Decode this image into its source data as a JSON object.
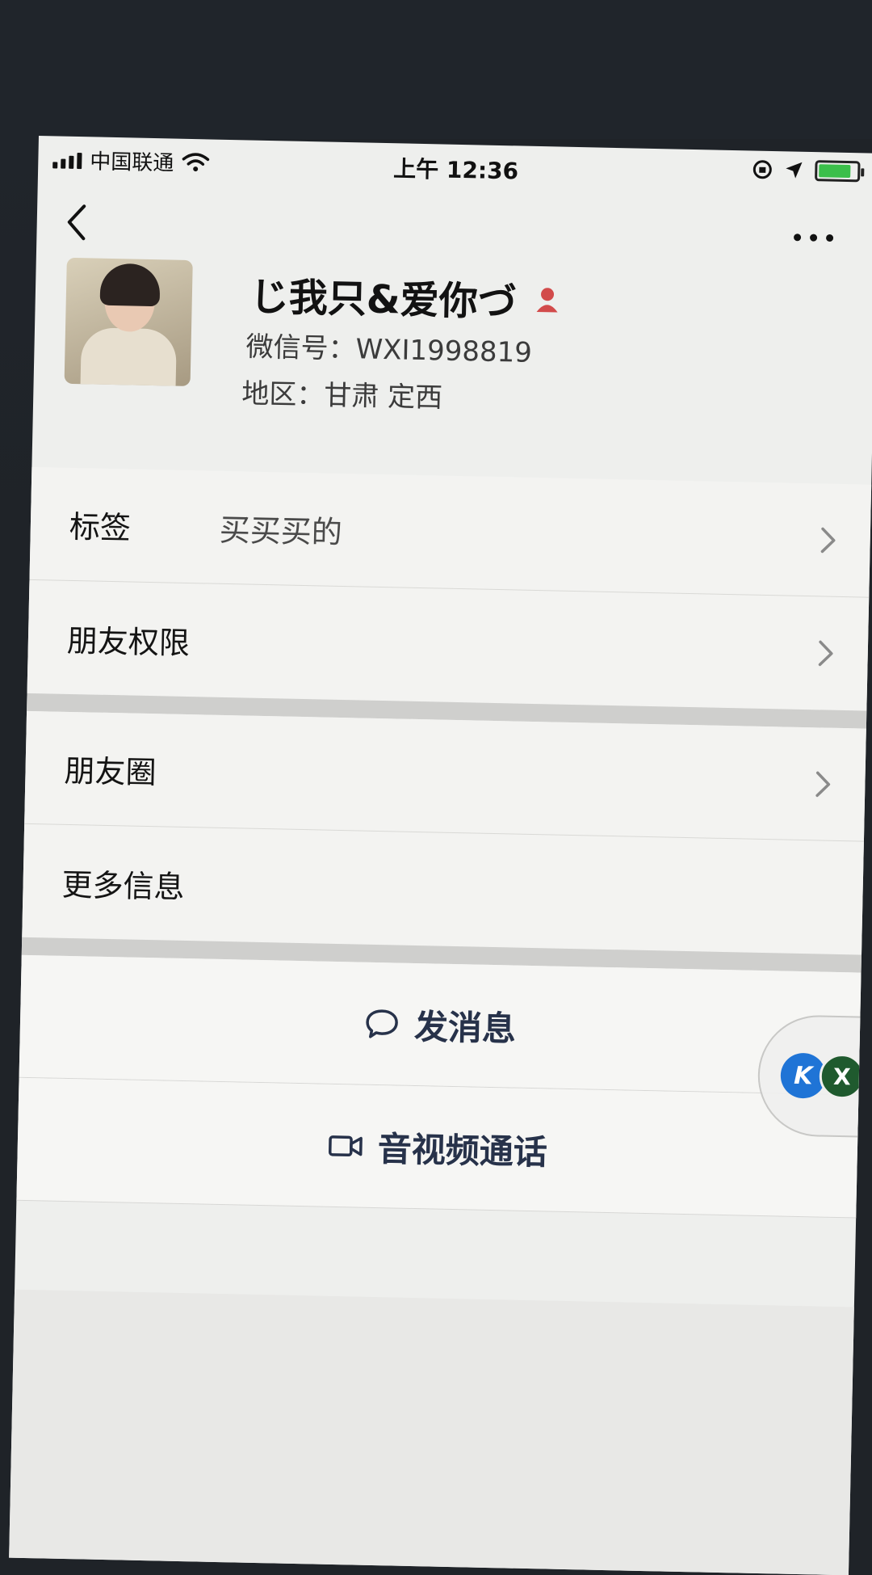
{
  "status_bar": {
    "carrier": "中国联通",
    "time": "上午 12:36",
    "battery_level": 0.85
  },
  "nav": {
    "back_icon": "chevron-left-icon",
    "more_icon": "ellipsis-icon"
  },
  "profile": {
    "name": "じ我只&爱你づ",
    "gender_icon": "female-icon",
    "wechat_id": "微信号：WXI1998819",
    "region": "地区：甘肃 定西"
  },
  "list_section_1": [
    {
      "label": "标签",
      "value": "买买买的"
    },
    {
      "label": "朋友权限",
      "value": ""
    }
  ],
  "list_section_2": [
    {
      "label": "朋友圈",
      "value": ""
    },
    {
      "label": "更多信息",
      "value": ""
    }
  ],
  "actions": {
    "send_message": "发消息",
    "av_call": "音视频通话"
  },
  "floating_widget": {
    "k_label": "K",
    "x_label": "X"
  }
}
